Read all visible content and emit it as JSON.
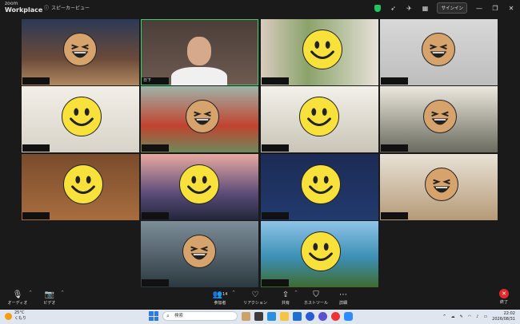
{
  "app": {
    "logo_top": "zoom",
    "logo_main": "Workplace",
    "view_mode": "スピーカービュー"
  },
  "titlebar": {
    "signin_label": "サインイン"
  },
  "participants": [
    {
      "name": ""
    },
    {
      "name": "日下"
    },
    {
      "name": ""
    },
    {
      "name": ""
    },
    {
      "name": ""
    },
    {
      "name": ""
    },
    {
      "name": ""
    },
    {
      "name": ""
    },
    {
      "name": ""
    },
    {
      "name": ""
    },
    {
      "name": ""
    },
    {
      "name": ""
    },
    {
      "name": ""
    },
    {
      "name": ""
    },
    {
      "name": ""
    },
    {
      "name": ""
    },
    {
      "name": ""
    },
    {
      "name": ""
    }
  ],
  "controls": {
    "audio": "オーディオ",
    "video": "ビデオ",
    "participants": "参加者",
    "participants_count": "14",
    "reactions": "リアクション",
    "share": "共有",
    "host_tools": "ホストツール",
    "more": "詳細",
    "end": "終了"
  },
  "taskbar": {
    "temperature": "25°C",
    "weather_text": "くもり",
    "search_placeholder": "検索",
    "time": "22:02",
    "date": "2026/08/31"
  },
  "colors": {
    "active_speaker": "#3bd16f",
    "end_button": "#e02b2b",
    "emoji_yellow": "#f7e13a",
    "emoji_tan": "#d7a36c"
  }
}
